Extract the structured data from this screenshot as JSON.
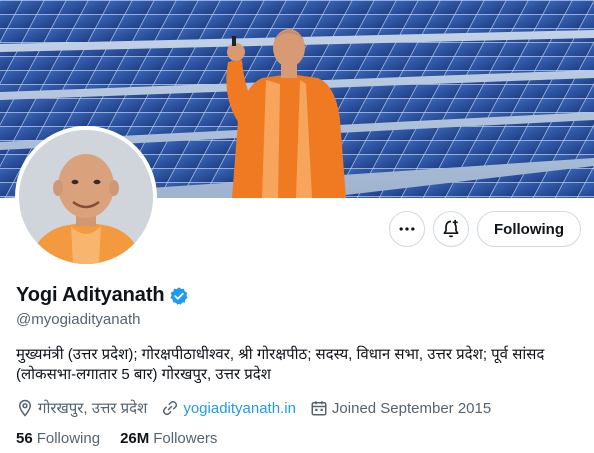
{
  "profile": {
    "name": "Yogi Adityanath",
    "handle": "@myogiadityanath",
    "bio": "मुख्यमंत्री (उत्तर प्रदेश); गोरक्षपीठाधीश्वर, श्री गोरक्षपीठ; सदस्य, विधान सभा, उत्तर प्रदेश; पूर्व सांसद (लोकसभा-लगातार 5 बार) गोरखपुर, उत्तर प्रदेश",
    "location": "गोरखपुर, उत्तर प्रदेश",
    "website": "yogiadityanath.in",
    "joined": "Joined September 2015",
    "verified_icon": "verified-badge-icon"
  },
  "actions": {
    "more_icon": "more-horizontal-icon",
    "notify_icon": "bell-plus-icon",
    "following_label": "Following"
  },
  "stats": {
    "following_count": "56",
    "following_label": "Following",
    "followers_count": "26M",
    "followers_label": "Followers"
  },
  "colors": {
    "accent": "#1d9bf0",
    "text_primary": "#0f1419",
    "text_secondary": "#536471",
    "border": "#cfd9de"
  }
}
